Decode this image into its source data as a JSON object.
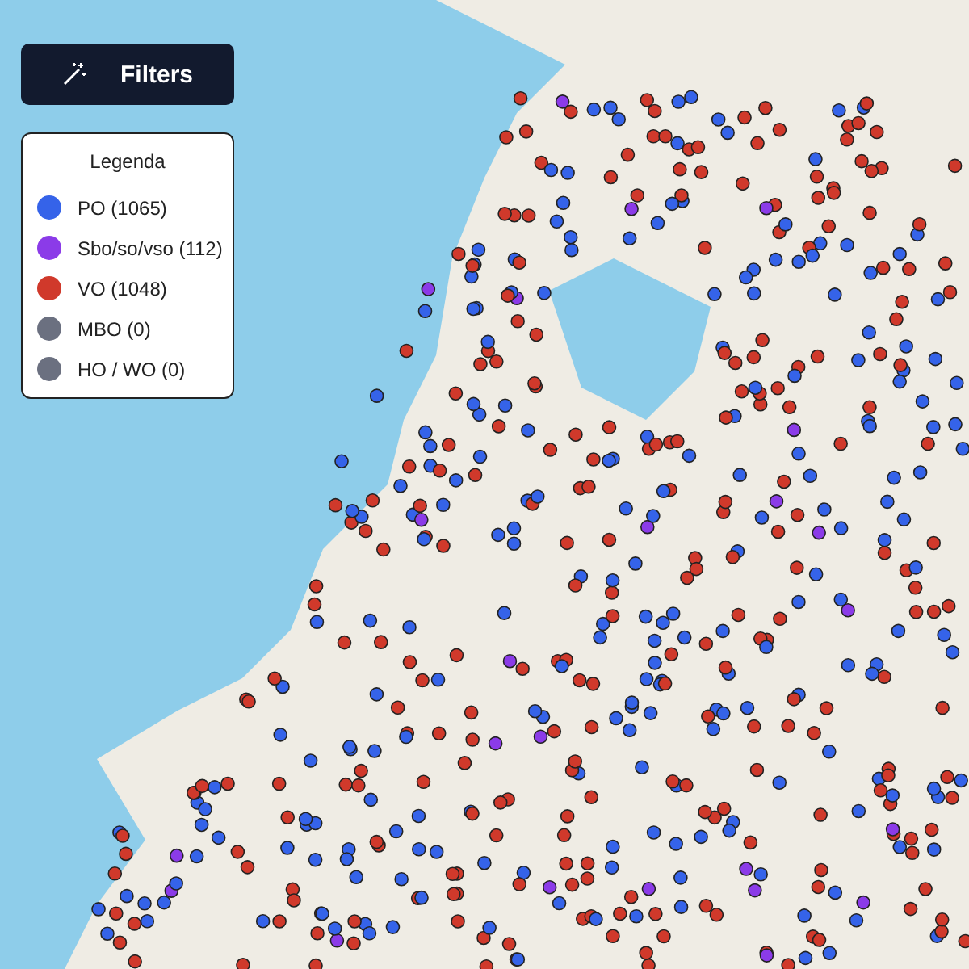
{
  "filters_button": {
    "label": "Filters"
  },
  "legend": {
    "title": "Legenda",
    "items": [
      {
        "label": "PO (1065)",
        "color": "#3563e9"
      },
      {
        "label": "Sbo/so/vso (112)",
        "color": "#8b3be8"
      },
      {
        "label": "VO (1048)",
        "color": "#d0392b"
      },
      {
        "label": "MBO (0)",
        "color": "#6b7080"
      },
      {
        "label": "HO / WO (0)",
        "color": "#6b7080"
      }
    ]
  }
}
